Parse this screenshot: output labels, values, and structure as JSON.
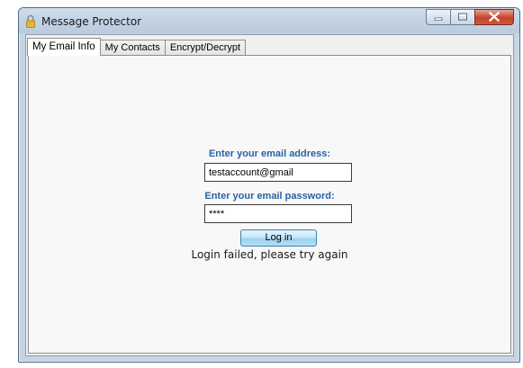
{
  "window": {
    "title": "Message Protector",
    "icons": {
      "app": "lock-icon",
      "minimize": "minimize-icon",
      "maximize": "maximize-icon",
      "close": "close-icon"
    }
  },
  "tabs": [
    {
      "label": "My Email Info",
      "active": true
    },
    {
      "label": "My Contacts",
      "active": false
    },
    {
      "label": "Encrypt/Decrypt",
      "active": false
    }
  ],
  "form": {
    "email_label": "Enter your email address:",
    "email_value": "testaccount@gmail",
    "password_label": "Enter your email password:",
    "password_value": "****",
    "login_button": "Log in",
    "status_message": "Login failed, please try again"
  },
  "colors": {
    "label_blue": "#2a62a6",
    "button_blue": "#98d1ef",
    "close_red": "#c0442a"
  }
}
